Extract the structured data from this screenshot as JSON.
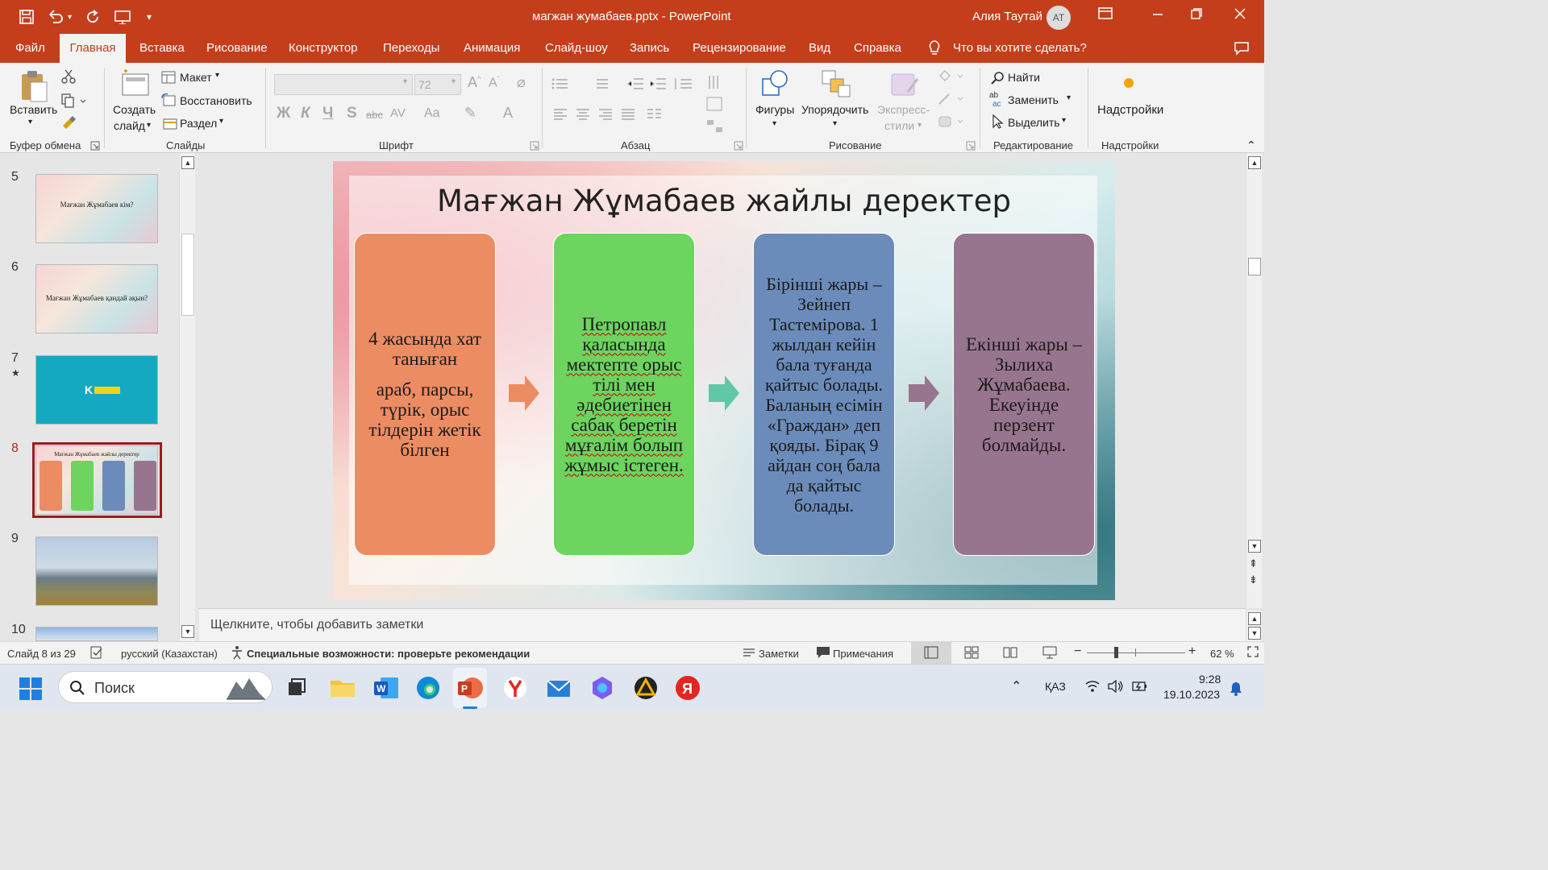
{
  "window": {
    "title": "магжан жумабаев.pptx  -  PowerPoint",
    "user_name": "Алия Таутай",
    "user_initials": "АТ"
  },
  "tabs": [
    {
      "label": "Файл"
    },
    {
      "label": "Главная"
    },
    {
      "label": "Вставка"
    },
    {
      "label": "Рисование"
    },
    {
      "label": "Конструктор"
    },
    {
      "label": "Переходы"
    },
    {
      "label": "Анимация"
    },
    {
      "label": "Слайд-шоу"
    },
    {
      "label": "Запись"
    },
    {
      "label": "Рецензирование"
    },
    {
      "label": "Вид"
    },
    {
      "label": "Справка"
    }
  ],
  "tell_me": "Что вы хотите сделать?",
  "ribbon": {
    "clipboard": {
      "paste": "Вставить",
      "group": "Буфер обмена"
    },
    "slides": {
      "new_slide_1": "Создать",
      "new_slide_2": "слайд",
      "layout": "Макет",
      "reset": "Восстановить",
      "section": "Раздел",
      "group": "Слайды"
    },
    "font": {
      "size": "72",
      "bold": "Ж",
      "italic": "К",
      "underline": "Ч",
      "shadow": "S",
      "strike": "abc",
      "spacing": "AV",
      "case": "Aa",
      "group": "Шрифт"
    },
    "paragraph": {
      "group": "Абзац"
    },
    "drawing": {
      "shapes": "Фигуры",
      "arrange": "Упорядочить",
      "styles_1": "Экспресс-",
      "styles_2": "стили",
      "group": "Рисование"
    },
    "editing": {
      "find": "Найти",
      "replace": "Заменить",
      "select": "Выделить",
      "group": "Редактирование"
    },
    "addins": {
      "button": "Надстройки",
      "group": "Надстройки"
    }
  },
  "thumbnails": [
    {
      "number": "5",
      "text": "Мағжан Жұмабаев кім?"
    },
    {
      "number": "6",
      "text": "Мағжан Жұмабаев қандай ақын?"
    },
    {
      "number": "7",
      "text": "K"
    },
    {
      "number": "8",
      "text": "Мағжан Жұмабаев жайлы деректер"
    },
    {
      "number": "9",
      "text": ""
    },
    {
      "number": "10",
      "text": ""
    }
  ],
  "slide": {
    "title": "Мағжан Жұмабаев жайлы деректер",
    "boxes": [
      {
        "p1": "4 жасында хат таныған",
        "p2": "араб, парсы, түрік, орыс тілдерін жетік білген",
        "color": "#ec8c63"
      },
      {
        "p1": "Петропавл қаласында мектепте орыс тілі мен әдебиетінен сабақ беретін мұғалім болып жұмыс істеген.",
        "color": "#6dd45f"
      },
      {
        "p1": "Бірінші жары – Зейнеп Тастемірова. 1 жылдан кейін бала туғанда қайтыс болады. Баланың есімін «Граждан» деп қояды. Бірақ 9 айдан соң бала да қайтыс болады.",
        "color": "#6b8cba"
      },
      {
        "p1": "Екінші жары – Зылиха Жұмабаева. Екеуінде перзент болмайды.",
        "color": "#98758f"
      }
    ],
    "arrow_colors": [
      "#ec8c63",
      "#5fc8a7",
      "#98758f"
    ]
  },
  "notes_placeholder": "Щелкните, чтобы добавить заметки",
  "status": {
    "slide_counter": "Слайд 8 из 29",
    "language": "русский (Казахстан)",
    "accessibility": "Специальные возможности: проверьте рекомендации",
    "notes": "Заметки",
    "comments": "Примечания",
    "zoom": "62 %"
  },
  "taskbar": {
    "search": "Поиск",
    "lang": "ҚАЗ",
    "time": "9:28",
    "date": "19.10.2023"
  }
}
